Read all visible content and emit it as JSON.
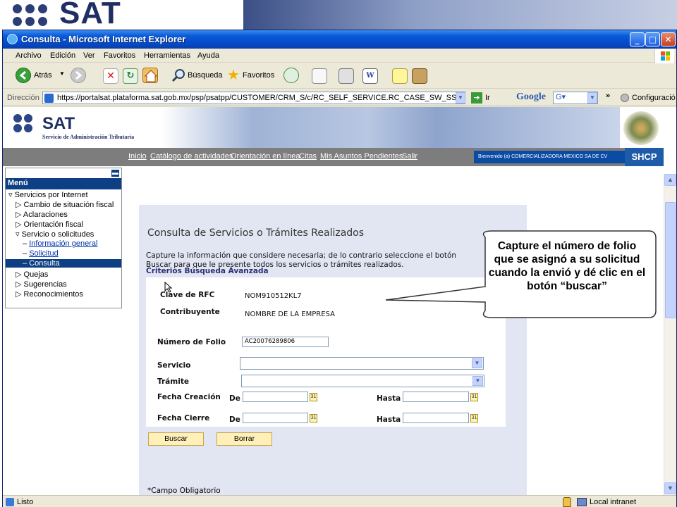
{
  "browser": {
    "title": "Consulta - Microsoft Internet Explorer",
    "menu": [
      "Archivo",
      "Edición",
      "Ver",
      "Favoritos",
      "Herramientas",
      "Ayuda"
    ],
    "toolbar": {
      "back": "Atrás",
      "search": "Búsqueda",
      "favorites": "Favoritos"
    },
    "address_label": "Dirección",
    "address_url": "https://portalsat.plataforma.sat.gob.mx/psp/psatpp/CUSTOMER/CRM_S/c/RC_SELF_SERVICE.RC_CASE_SW_SS_SRCH.GBL",
    "go_label": "Ir",
    "google_label": "Google",
    "config_label": "Configuració",
    "status_left": "Listo",
    "status_right": "Local intranet"
  },
  "slide": {
    "logo_text": "SAT"
  },
  "header": {
    "logo_text": "SAT",
    "logo_subtitle": "Servicio de Administración Tributaria",
    "nav": [
      "Inicio",
      "Catálogo de actividades",
      "Orientación en línea",
      "Citas",
      "Mis Asuntos Pendientes",
      "Salir"
    ],
    "welcome": "Bienvenido (a) COMERCIALIZADORA MEXICO SA DE CV",
    "shcp": "SHCP"
  },
  "menu": {
    "header": "Menú",
    "items": [
      {
        "label": "Servicios por Internet"
      },
      {
        "label": "Cambio de situación fiscal"
      },
      {
        "label": "Aclaraciones"
      },
      {
        "label": "Orientación fiscal"
      },
      {
        "label": "Servicio o solicitudes"
      },
      {
        "label": "Información general"
      },
      {
        "label": "Solicitud"
      },
      {
        "label": "Consulta"
      },
      {
        "label": "Quejas"
      },
      {
        "label": "Sugerencias"
      },
      {
        "label": "Reconocimientos"
      }
    ]
  },
  "form": {
    "title": "Consulta de Servicios o Trámites Realizados",
    "description": "Capture la información que considere necesaria; de lo contrario seleccione el botón Buscar para que le presente todos los servicios o trámites realizados.",
    "criteria_title": "Criterios Búsqueda Avanzada",
    "rfc_label": "Clave de RFC",
    "rfc_value": "NOM910512KL7",
    "contrib_label": "Contribuyente",
    "contrib_value": "NOMBRE DE LA EMPRESA",
    "folio_label": "Número de Folio",
    "folio_value": "AC20076289806",
    "servicio_label": "Servicio",
    "tramite_label": "Trámite",
    "fecha_creacion_label": "Fecha Creación",
    "fecha_cierre_label": "Fecha Cierre",
    "de_label": "De",
    "hasta_label": "Hasta",
    "search_button": "Buscar",
    "clear_button": "Borrar",
    "required_note": "*Campo Obligatorio"
  },
  "callout": {
    "text": "Capture el número de folio que se asignó a su solicitud cuando la envió y dé clic en el botón “buscar”"
  }
}
